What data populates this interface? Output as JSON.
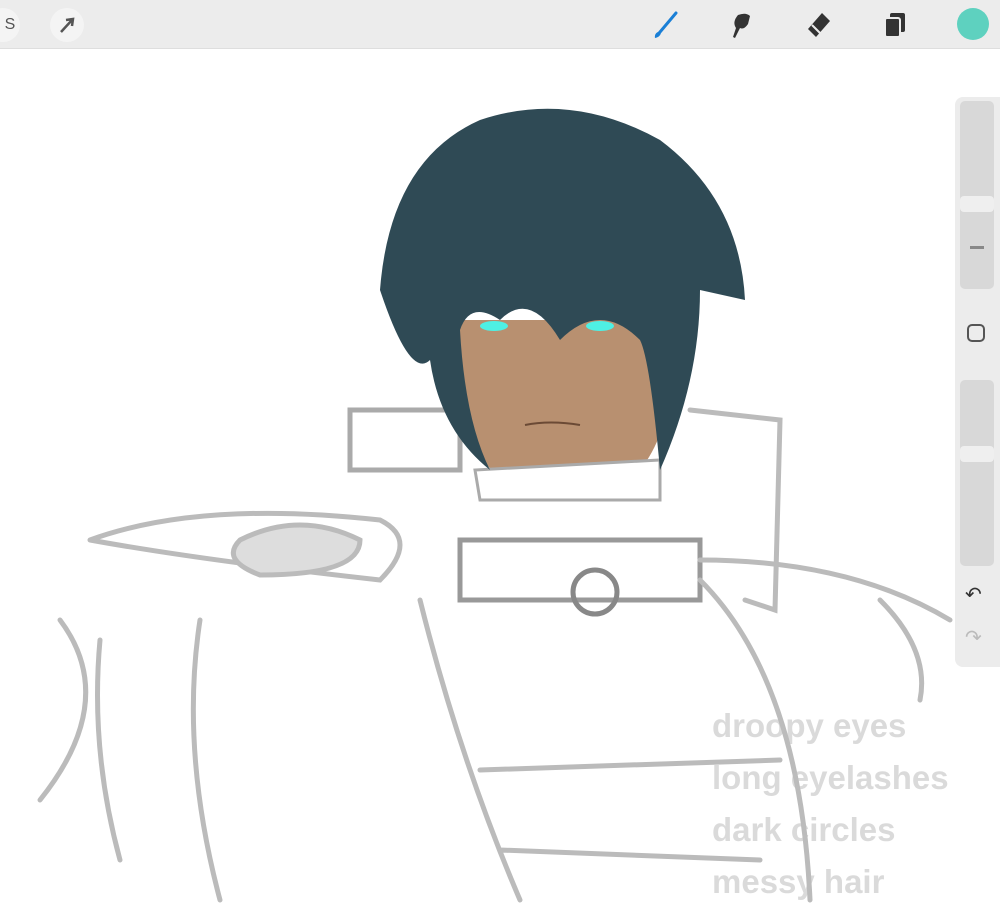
{
  "toolbar": {
    "left_buttons": [
      "selection-icon",
      "transform-icon"
    ],
    "tools": [
      "brush-icon",
      "smudge-icon",
      "eraser-icon",
      "layers-icon"
    ],
    "active_tool": "brush-icon",
    "active_color": "#5ed1bf",
    "brush_accent": "#1a7fd6"
  },
  "sidebar": {
    "brush_size": 0.45,
    "opacity": 0.61,
    "undo": "undo-icon",
    "redo": "redo-icon"
  },
  "canvas": {
    "notes": [
      "droopy eyes",
      "long eyelashes",
      "dark circles",
      "messy hair"
    ]
  }
}
